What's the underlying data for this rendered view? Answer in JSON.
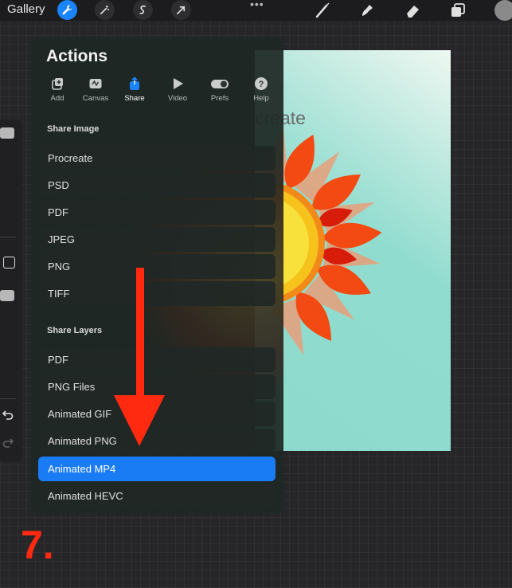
{
  "toolbar": {
    "gallery_label": "Gallery",
    "left_tools": [
      {
        "icon": "wrench-icon",
        "active": true
      },
      {
        "icon": "magic-wand-icon",
        "active": false
      },
      {
        "icon": "adjustments-s-icon",
        "active": false
      },
      {
        "icon": "cursor-arrow-icon",
        "active": false
      }
    ],
    "more": "•••",
    "right_tools": [
      "brush-icon",
      "smudge-icon",
      "eraser-icon",
      "layers-icon",
      "color-swatch"
    ]
  },
  "canvas": {
    "title_fragment": "create"
  },
  "actions": {
    "title": "Actions",
    "tabs": [
      {
        "label": "Add",
        "icon": "add-icon"
      },
      {
        "label": "Canvas",
        "icon": "canvas-icon"
      },
      {
        "label": "Share",
        "icon": "share-icon",
        "active": true
      },
      {
        "label": "Video",
        "icon": "video-play-icon"
      },
      {
        "label": "Prefs",
        "icon": "toggle-icon"
      },
      {
        "label": "Help",
        "icon": "help-icon"
      }
    ],
    "share_image": {
      "heading": "Share Image",
      "items": [
        "Procreate",
        "PSD",
        "PDF",
        "JPEG",
        "PNG",
        "TIFF"
      ]
    },
    "share_layers": {
      "heading": "Share Layers",
      "items": [
        "PDF",
        "PNG Files",
        "Animated GIF",
        "Animated PNG",
        "Animated MP4",
        "Animated HEVC"
      ],
      "selected": "Animated MP4"
    }
  },
  "annotation": {
    "step_label": "7.",
    "arrow_color": "#ff2a10"
  },
  "colors": {
    "accent": "#1a84ff",
    "selected_row": "#1a7cf5"
  }
}
